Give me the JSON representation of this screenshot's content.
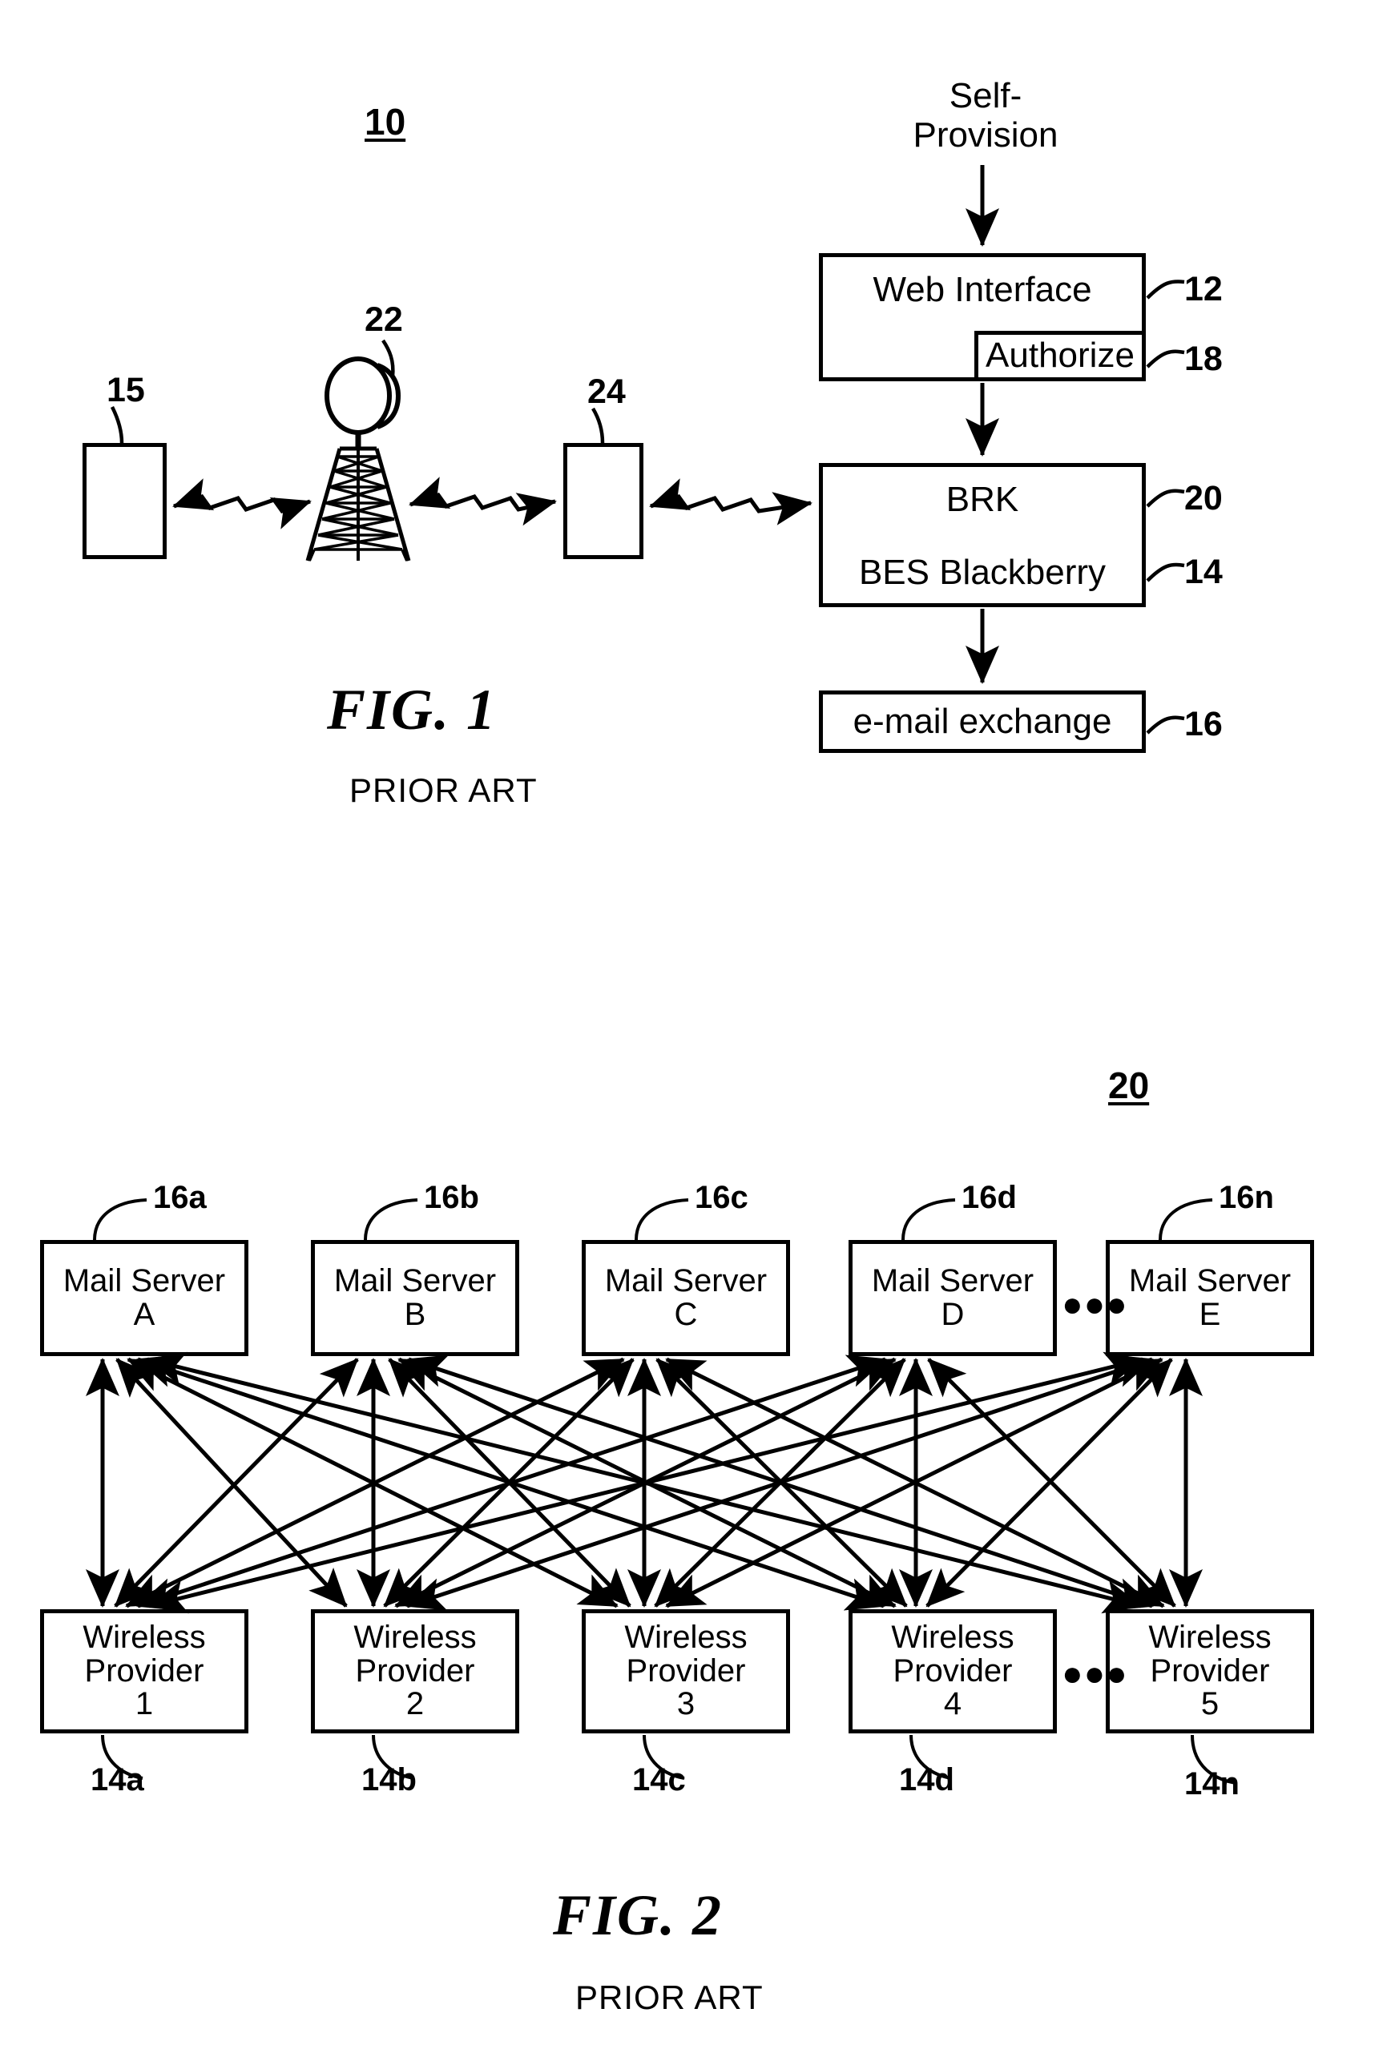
{
  "document": {
    "type": "patent-drawing-sheet",
    "figures": [
      "FIG. 1",
      "FIG. 2"
    ]
  },
  "figure1": {
    "figure_number": "10",
    "caption": "FIG. 1",
    "prior_art": "PRIOR ART",
    "input_label": "Self-\nProvision",
    "blocks": [
      {
        "id": "device",
        "label": "",
        "ref": "15"
      },
      {
        "id": "tower",
        "label": "",
        "ref": "22"
      },
      {
        "id": "gateway",
        "label": "",
        "ref": "24"
      },
      {
        "id": "web-interface",
        "label": "Web Interface",
        "ref": "12"
      },
      {
        "id": "authorize",
        "label": "Authorize",
        "ref": "18"
      },
      {
        "id": "brk",
        "label": "BRK",
        "ref": "20"
      },
      {
        "id": "bes",
        "label": "BES Blackberry",
        "ref": "14"
      },
      {
        "id": "email",
        "label": "e-mail exchange",
        "ref": "16"
      }
    ],
    "refs": {
      "device": "15",
      "tower": "22",
      "gateway": "24",
      "web_interface": "12",
      "authorize": "18",
      "brk": "20",
      "bes": "14",
      "email": "16"
    },
    "labels": {
      "web_interface": "Web Interface",
      "authorize": "Authorize",
      "brk": "BRK",
      "bes": "BES Blackberry",
      "email": "e-mail exchange"
    }
  },
  "figure2": {
    "figure_number": "20",
    "caption": "FIG. 2",
    "prior_art": "PRIOR ART",
    "ellipsis": "●●●",
    "mail_servers": [
      {
        "line1": "Mail Server",
        "line2": "A",
        "ref": "16a"
      },
      {
        "line1": "Mail Server",
        "line2": "B",
        "ref": "16b"
      },
      {
        "line1": "Mail Server",
        "line2": "C",
        "ref": "16c"
      },
      {
        "line1": "Mail Server",
        "line2": "D",
        "ref": "16d"
      },
      {
        "line1": "Mail Server",
        "line2": "E",
        "ref": "16n"
      }
    ],
    "wireless_providers": [
      {
        "line1": "Wireless",
        "line2": "Provider",
        "line3": "1",
        "ref": "14a"
      },
      {
        "line1": "Wireless",
        "line2": "Provider",
        "line3": "2",
        "ref": "14b"
      },
      {
        "line1": "Wireless",
        "line2": "Provider",
        "line3": "3",
        "ref": "14c"
      },
      {
        "line1": "Wireless",
        "line2": "Provider",
        "line3": "4",
        "ref": "14d"
      },
      {
        "line1": "Wireless",
        "line2": "Provider",
        "line3": "5",
        "ref": "14n"
      }
    ]
  },
  "colors": {
    "ink": "#000000",
    "paper": "#ffffff"
  }
}
